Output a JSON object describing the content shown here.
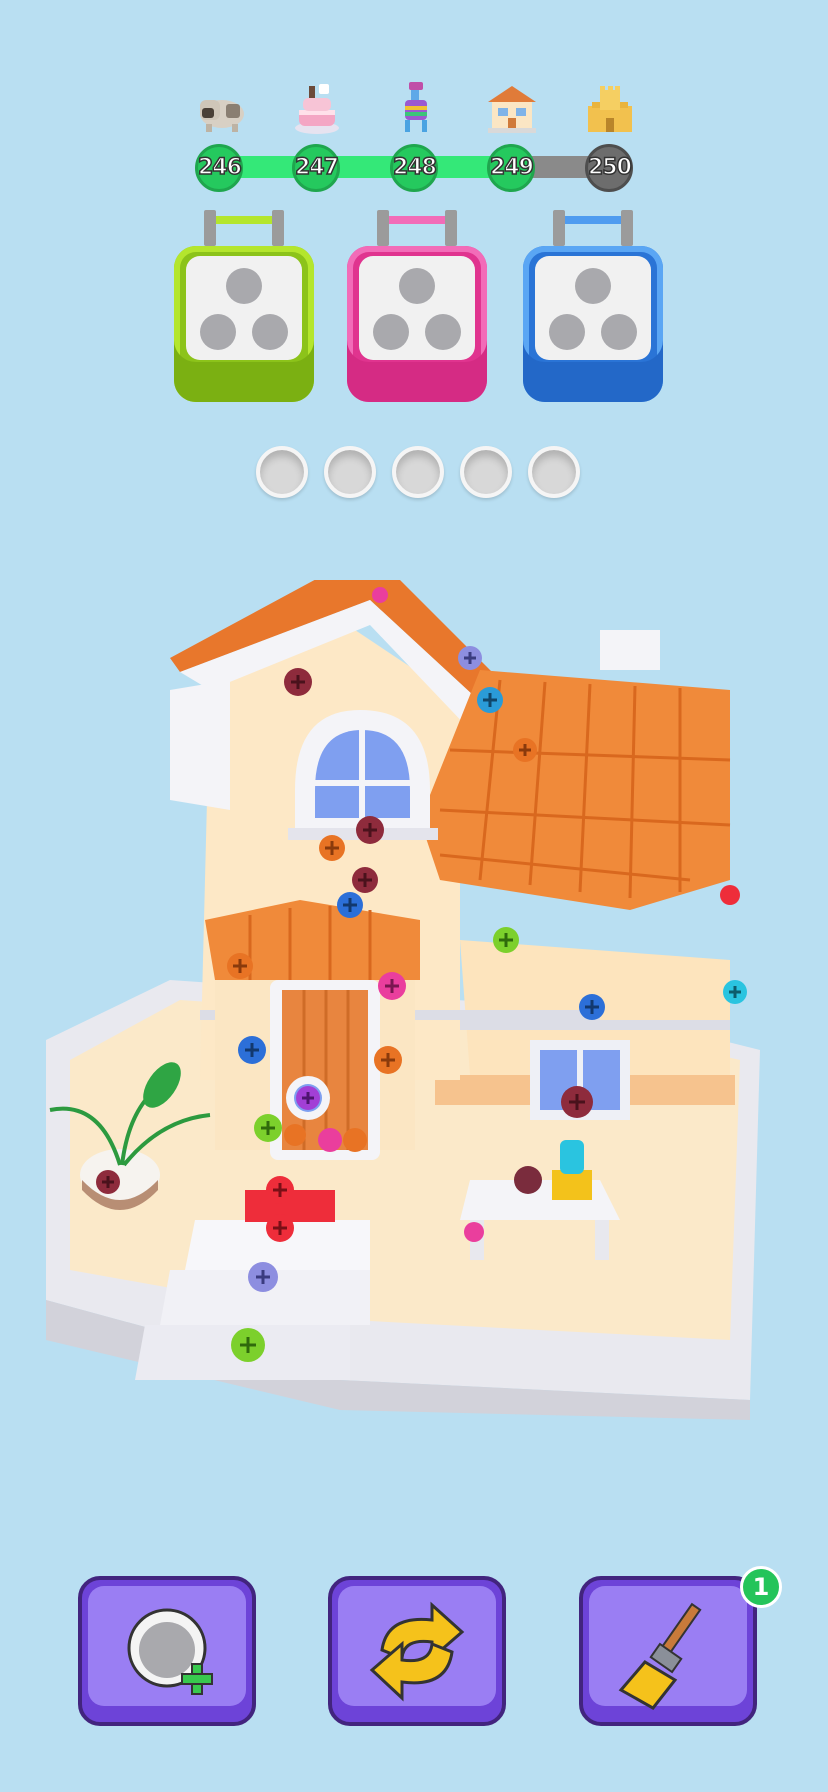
{
  "levels": [
    {
      "number": "246",
      "thumb": "pug-dog-icon",
      "state": "done"
    },
    {
      "number": "247",
      "thumb": "cake-icon",
      "state": "done"
    },
    {
      "number": "248",
      "thumb": "llama-pinata-icon",
      "state": "done"
    },
    {
      "number": "249",
      "thumb": "house-icon",
      "state": "current"
    },
    {
      "number": "250",
      "thumb": "sand-castle-icon",
      "state": "locked"
    }
  ],
  "level_progress": 0.75,
  "boxes": [
    {
      "color": "#9ad11a",
      "accent": "#b4e62d",
      "holes": 3
    },
    {
      "color": "#ea3e9d",
      "accent": "#f26cb8",
      "holes": 3
    },
    {
      "color": "#2a7fe0",
      "accent": "#4f9cf0",
      "holes": 3
    }
  ],
  "slots": {
    "empty": 5
  },
  "tools": [
    {
      "name": "add-slot",
      "icon": "add-hole-icon"
    },
    {
      "name": "shuffle",
      "icon": "shuffle-arrows-icon"
    },
    {
      "name": "broom",
      "icon": "broom-icon",
      "badge": "1"
    }
  ],
  "colors": {
    "background": "#b9dff2",
    "tool": "#9a7ef3",
    "tool_border": "#42247e"
  }
}
